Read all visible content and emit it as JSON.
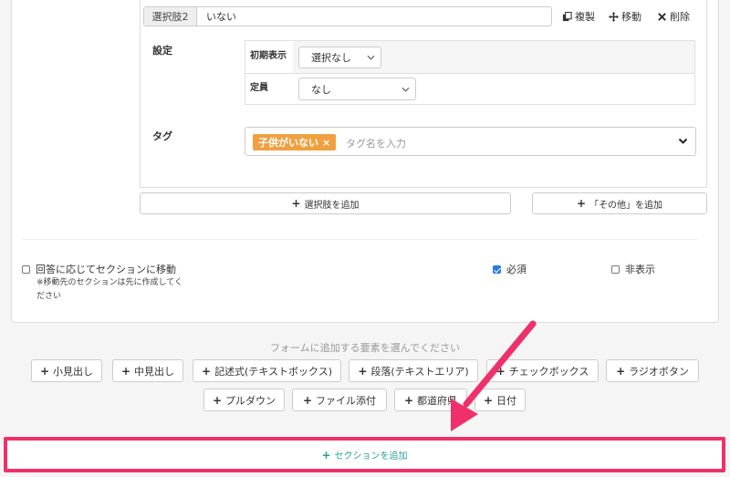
{
  "choice": {
    "label": "選択肢2",
    "value": "いない",
    "actions": {
      "duplicate": "複製",
      "move": "移動",
      "delete": "削除"
    }
  },
  "settings": {
    "label": "設定",
    "initial_display_label": "初期表示",
    "initial_display_value": "選択なし",
    "capacity_label": "定員",
    "capacity_value": "なし"
  },
  "tags": {
    "label": "タグ",
    "chip": "子供がいない",
    "chip_remove": "×",
    "placeholder": "タグ名を入力"
  },
  "buttons": {
    "add_choice": "選択肢を追加",
    "add_other": "「その他」を追加"
  },
  "options": {
    "branch_label": "回答に応じてセクションに移動",
    "branch_note": "※移動先のセクションは先に作成してください",
    "required_label": "必須",
    "hidden_label": "非表示",
    "branch_checked": false,
    "required_checked": true,
    "hidden_checked": false
  },
  "elements": {
    "hint": "フォームに追加する要素を選んでください",
    "row1": [
      "小見出し",
      "中見出し",
      "記述式(テキストボックス)",
      "段落(テキストエリア)",
      "チェックボックス",
      "ラジオボタン"
    ],
    "row2": [
      "プルダウン",
      "ファイル添付",
      "都道府県",
      "日付"
    ]
  },
  "add_section": "セクションを追加",
  "colors": {
    "tag_chip": "#f0a040",
    "highlight": "#f0306a",
    "add_section_text": "#26a09a",
    "checkbox_on": "#2a7ae2"
  }
}
